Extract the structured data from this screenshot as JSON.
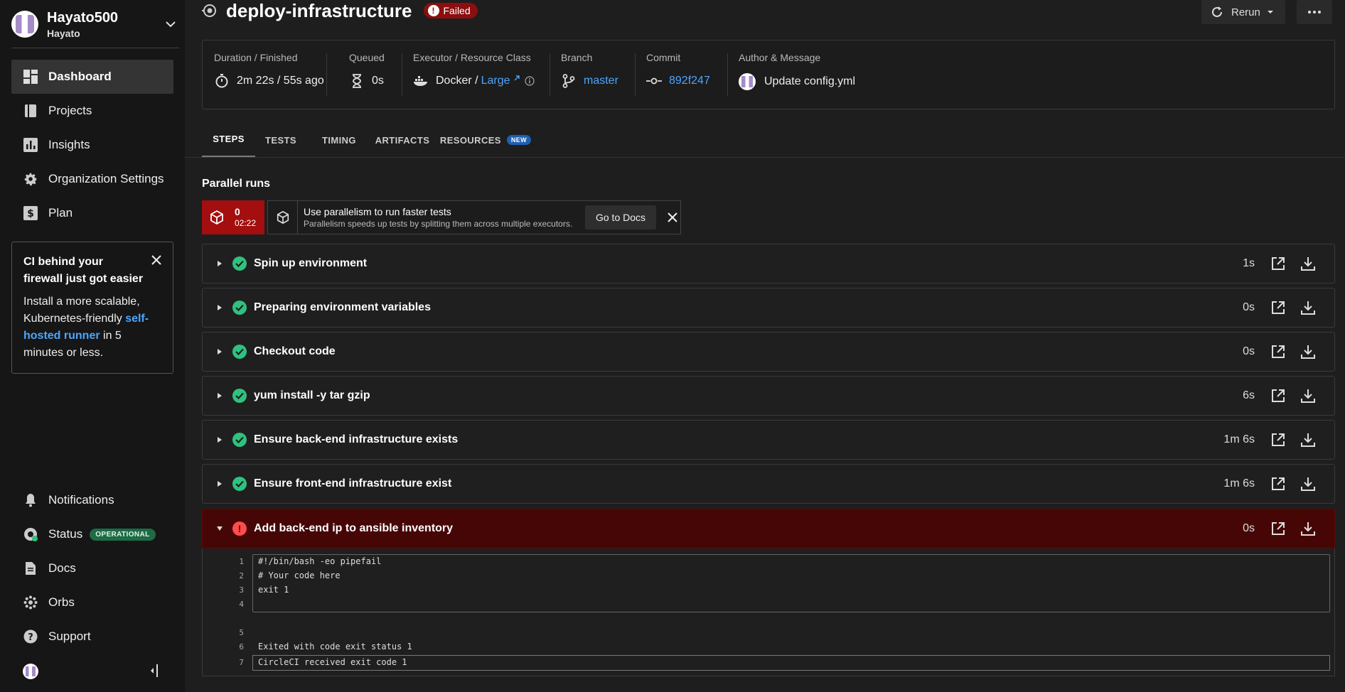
{
  "sidebar": {
    "org_name": "Hayato500",
    "org_sub": "Hayato",
    "nav": [
      {
        "label": "Dashboard",
        "icon": "dashboard-icon"
      },
      {
        "label": "Projects",
        "icon": "book-icon"
      },
      {
        "label": "Insights",
        "icon": "bar-chart-icon"
      },
      {
        "label": "Organization Settings",
        "icon": "gear-icon"
      },
      {
        "label": "Plan",
        "icon": "dollar-icon"
      }
    ],
    "promo": {
      "title": "CI behind your firewall just got easier",
      "body_pre": "Install a more scalable, Kubernetes-friendly ",
      "body_link": "self-hosted runner",
      "body_post": " in 5 minutes or less."
    },
    "bottom_nav": [
      {
        "label": "Notifications",
        "icon": "bell-icon"
      },
      {
        "label": "Status",
        "icon": "status-icon",
        "badge": "OPERATIONAL"
      },
      {
        "label": "Docs",
        "icon": "doc-icon"
      },
      {
        "label": "Orbs",
        "icon": "orb-icon"
      },
      {
        "label": "Support",
        "icon": "help-icon"
      }
    ]
  },
  "header": {
    "title": "deploy-infrastructure",
    "status": "Failed",
    "rerun_label": "Rerun"
  },
  "summary": {
    "duration_label": "Duration / Finished",
    "duration_value": "2m 22s / 55s ago",
    "queued_label": "Queued",
    "queued_value": "0s",
    "executor_label": "Executor / Resource Class",
    "executor_value": "Docker / ",
    "resource_class": "Large",
    "branch_label": "Branch",
    "branch_value": "master",
    "commit_label": "Commit",
    "commit_value": "892f247",
    "author_label": "Author & Message",
    "author_message": "Update config.yml"
  },
  "tabs": [
    {
      "label": "STEPS"
    },
    {
      "label": "TESTS"
    },
    {
      "label": "TIMING"
    },
    {
      "label": "ARTIFACTS"
    },
    {
      "label": "RESOURCES",
      "badge": "NEW"
    }
  ],
  "parallel": {
    "title": "Parallel runs",
    "run_index": "0",
    "run_time": "02:22",
    "tip_title": "Use parallelism to run faster tests",
    "tip_body": "Parallelism speeds up tests by splitting them across multiple executors.",
    "docs_button": "Go to Docs"
  },
  "steps": [
    {
      "name": "Spin up environment",
      "duration": "1s",
      "status": "success"
    },
    {
      "name": "Preparing environment variables",
      "duration": "0s",
      "status": "success"
    },
    {
      "name": "Checkout code",
      "duration": "0s",
      "status": "success"
    },
    {
      "name": "yum install -y tar gzip",
      "duration": "6s",
      "status": "success"
    },
    {
      "name": "Ensure back-end infrastructure exists",
      "duration": "1m 6s",
      "status": "success"
    },
    {
      "name": "Ensure front-end infrastructure exist",
      "duration": "1m 6s",
      "status": "success"
    },
    {
      "name": "Add back-end ip to ansible inventory",
      "duration": "0s",
      "status": "failed"
    }
  ],
  "log": {
    "line_numbers": [
      "1",
      "2",
      "3",
      "4",
      "5",
      "6",
      "7"
    ],
    "code": [
      "#!/bin/bash -eo pipefail",
      "# Your code here",
      "exit 1"
    ],
    "exit_line": "Exited with code exit status 1",
    "received_line": "CircleCI received exit code 1"
  },
  "colors": {
    "accent_link": "#4da5ff",
    "failed": "#8c0e0e",
    "success": "#2ec27e",
    "operational": "#1e6b46"
  }
}
